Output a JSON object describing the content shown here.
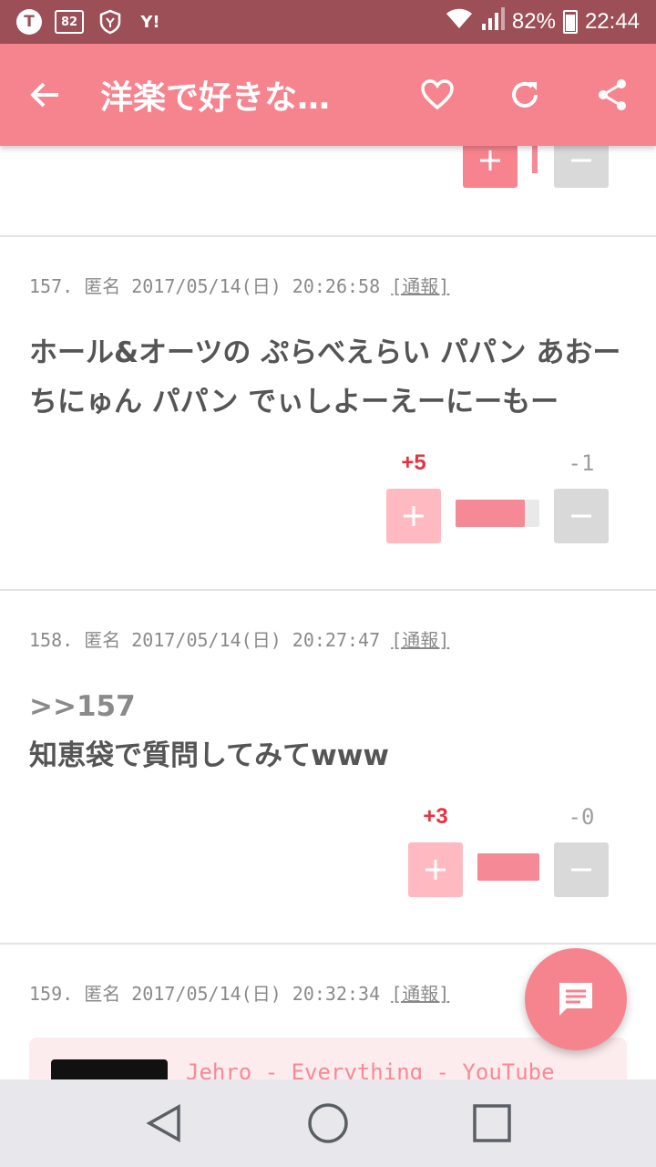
{
  "status_bar": {
    "icons": [
      "t-circle-icon",
      "app-box-icon",
      "shield-y-icon",
      "yahoo-icon"
    ],
    "left_labels": [
      "T",
      "82",
      "Y!"
    ],
    "battery": "82%",
    "time": "22:44"
  },
  "app_bar": {
    "title": "洋楽で好きな…"
  },
  "posts": [
    {
      "meta_number": "157.",
      "meta_author": "匿名",
      "meta_date": "2017/05/14(日) 20:26:58",
      "report": "[通報]",
      "body": "ホール&オーツの ぷらべえらい パパン あおーちにゅん パパン でぃしよーえーにーもー",
      "plus_count": "+5",
      "minus_count": "-1",
      "plus_ratio": 0.83
    },
    {
      "meta_number": "158.",
      "meta_author": "匿名",
      "meta_date": "2017/05/14(日) 20:27:47",
      "report": "[通報]",
      "anchor": ">>157",
      "body": "知恵袋で質問してみてwww",
      "plus_count": "+3",
      "minus_count": "-0",
      "plus_ratio": 1.0
    },
    {
      "meta_number": "159.",
      "meta_author": "匿名",
      "meta_date": "2017/05/14(日) 20:32:34",
      "report": "[通報]",
      "link_title": "Jehro - Everything - YouTube"
    }
  ],
  "colors": {
    "status_bar": "#9c4f57",
    "app_bar": "#f5848f",
    "plus_count": "#e8323f",
    "fab": "#f5848f"
  }
}
